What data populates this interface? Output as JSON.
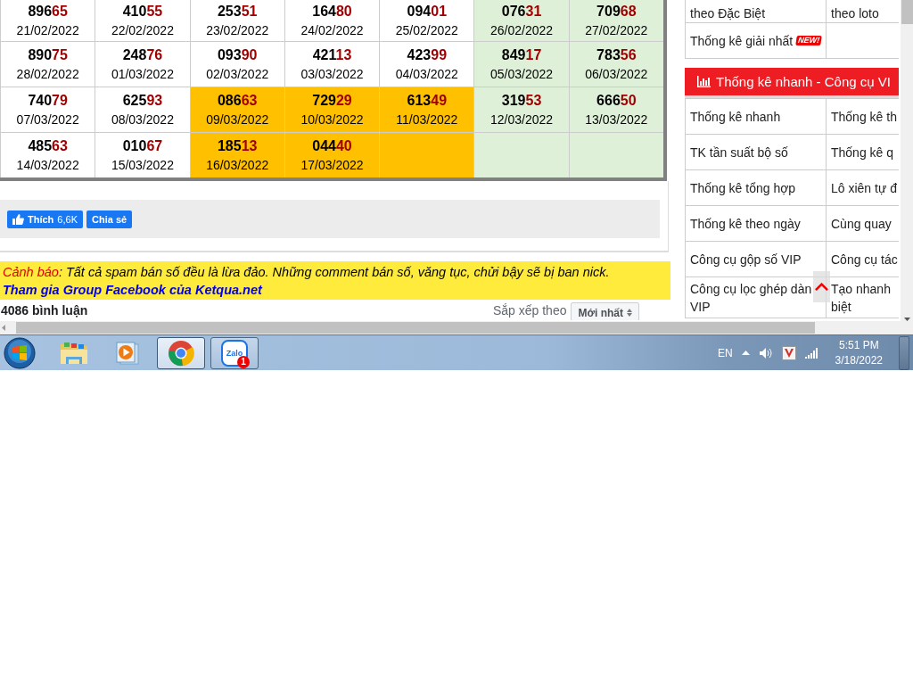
{
  "results": {
    "rows": [
      [
        {
          "number": "89665",
          "date": "21/02/2022",
          "color": "#ffffff"
        },
        {
          "number": "41055",
          "date": "22/02/2022",
          "color": "#ffffff"
        },
        {
          "number": "25351",
          "date": "23/02/2022",
          "color": "#ffffff"
        },
        {
          "number": "16480",
          "date": "24/02/2022",
          "color": "#ffffff"
        },
        {
          "number": "09401",
          "date": "25/02/2022",
          "color": "#ffffff"
        },
        {
          "number": "07631",
          "date": "26/02/2022",
          "color": "#dff0d8"
        },
        {
          "number": "70968",
          "date": "27/02/2022",
          "color": "#dff0d8"
        }
      ],
      [
        {
          "number": "89075",
          "date": "28/02/2022",
          "color": "#ffffff"
        },
        {
          "number": "24876",
          "date": "01/03/2022",
          "color": "#ffffff"
        },
        {
          "number": "09390",
          "date": "02/03/2022",
          "color": "#ffffff"
        },
        {
          "number": "42113",
          "date": "03/03/2022",
          "color": "#ffffff"
        },
        {
          "number": "42399",
          "date": "04/03/2022",
          "color": "#ffffff"
        },
        {
          "number": "84917",
          "date": "05/03/2022",
          "color": "#dff0d8"
        },
        {
          "number": "78356",
          "date": "06/03/2022",
          "color": "#dff0d8"
        }
      ],
      [
        {
          "number": "74079",
          "date": "07/03/2022",
          "color": "#ffffff"
        },
        {
          "number": "62593",
          "date": "08/03/2022",
          "color": "#ffffff"
        },
        {
          "number": "08663",
          "date": "09/03/2022",
          "color": "#ffc000"
        },
        {
          "number": "72929",
          "date": "10/03/2022",
          "color": "#ffc000"
        },
        {
          "number": "61349",
          "date": "11/03/2022",
          "color": "#ffc000"
        },
        {
          "number": "31953",
          "date": "12/03/2022",
          "color": "#dff0d8"
        },
        {
          "number": "66650",
          "date": "13/03/2022",
          "color": "#dff0d8"
        }
      ],
      [
        {
          "number": "48563",
          "date": "14/03/2022",
          "color": "#ffffff"
        },
        {
          "number": "01067",
          "date": "15/03/2022",
          "color": "#ffffff"
        },
        {
          "number": "18513",
          "date": "16/03/2022",
          "color": "#ffc000"
        },
        {
          "number": "04440",
          "date": "17/03/2022",
          "color": "#ffc000"
        },
        {
          "color": "#ffc000"
        },
        {
          "color": "#dff0d8"
        },
        {
          "color": "#dff0d8"
        }
      ]
    ]
  },
  "social": {
    "like_label": "Thích",
    "like_count": "6,6K",
    "share_label": "Chia sẻ"
  },
  "warning": {
    "label": "Cảnh báo",
    "message": ": Tất cả spam bán số đều là lừa đảo. Những comment bán số, văng tục, chửi bậy sẽ bị ban nick.",
    "link": "Tham gia Group Facebook của Ketqua.net"
  },
  "comments": {
    "count": "4086 bình luận",
    "sort_label": "Sắp xếp theo",
    "sort_value": "Mới nhất"
  },
  "sidebar": {
    "top_rows": [
      {
        "cells": [
          "theo Đặc Biệt",
          "theo loto"
        ]
      },
      {
        "cells": [
          "Thống kê giải nhất"
        ],
        "badge": "NEW!"
      }
    ],
    "header": "Thống kê nhanh - Công cụ VI",
    "tool_rows": [
      {
        "cells": [
          "Thống kê nhanh",
          "Thống kê th"
        ]
      },
      {
        "cells": [
          "TK tần suất bộ số",
          "Thống kê q"
        ]
      },
      {
        "cells": [
          "Thống kê tổng hợp",
          "Lô xiên tự đ"
        ]
      },
      {
        "cells": [
          "Thống kê theo ngày",
          "Cùng quay"
        ]
      },
      {
        "cells": [
          "Công cụ gộp số VIP",
          "Công cụ tác"
        ]
      },
      {
        "cells": [
          "Công cụ lọc ghép dàn VIP",
          "Tạo nhanh biệt"
        ]
      }
    ]
  },
  "taskbar": {
    "apps": [
      {
        "kind": "explorer",
        "running": false,
        "selected": false
      },
      {
        "kind": "media",
        "running": false,
        "selected": false
      },
      {
        "kind": "chrome",
        "running": true,
        "selected": true
      },
      {
        "kind": "zalo",
        "running": true,
        "selected": false,
        "logo_text": "Zalo",
        "badge": "1"
      }
    ],
    "tray": {
      "language": "EN",
      "time": "5:51 PM",
      "date": "3/18/2022"
    }
  }
}
